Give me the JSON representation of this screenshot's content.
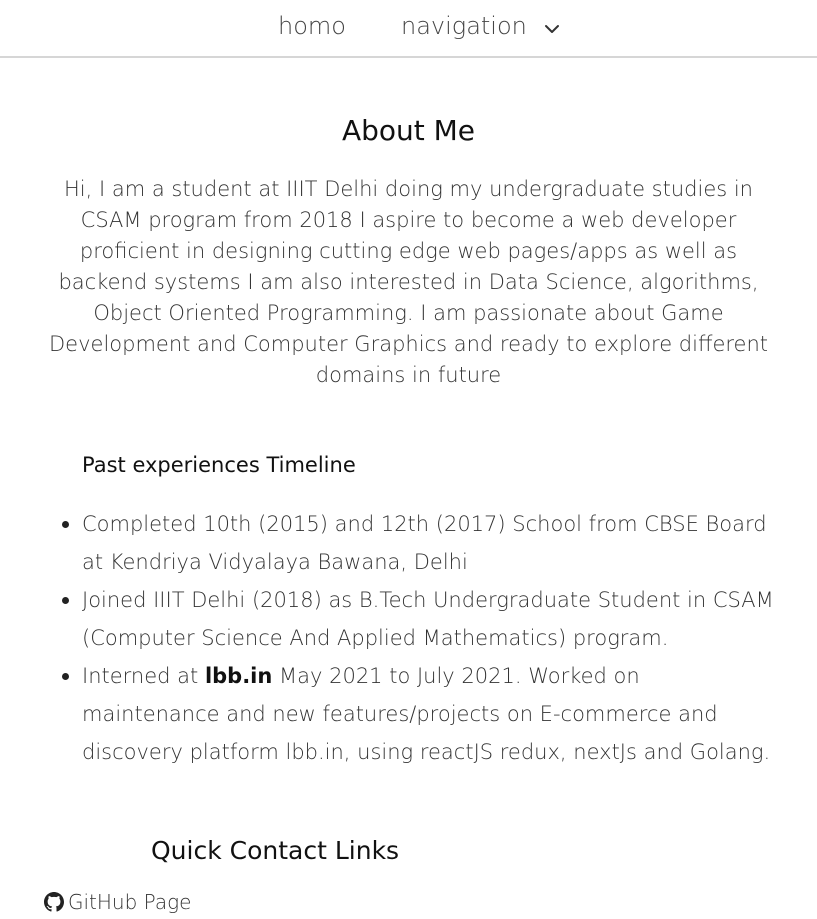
{
  "nav": {
    "home_label": "homo",
    "navigation_label": "navigation",
    "dropdown_icon": "chevron-down-icon"
  },
  "about": {
    "title": "About Me",
    "body": "Hi, I am a student at IIIT Delhi doing my undergraduate studies in CSAM program from 2018 I aspire to become a web developer proficient in designing cutting edge web pages/apps as well as backend systems I am also interested in Data Science, algorithms, Object Oriented Programming. I am passionate about Game Development and Computer Graphics and ready to explore different domains in future"
  },
  "timeline": {
    "title": "Past experiences Timeline",
    "items": [
      {
        "text": "Completed 10th (2015) and 12th (2017) School from CBSE Board at Kendriya Vidyalaya Bawana, Delhi"
      },
      {
        "text": "Joined IIIT Delhi (2018) as B.Tech Undergraduate Student in CSAM (Computer Science And Applied Mathematics) program."
      },
      {
        "prefix": "Interned at ",
        "link": "lbb.in",
        "suffix": " May 2021 to July 2021. Worked on maintenance and new features/projects on E-commerce and discovery platform lbb.in, using reactJS redux, nextJs and Golang."
      }
    ]
  },
  "contact": {
    "title": "Quick Contact Links",
    "github_label": "GitHub Page",
    "github_icon": "github-icon"
  }
}
